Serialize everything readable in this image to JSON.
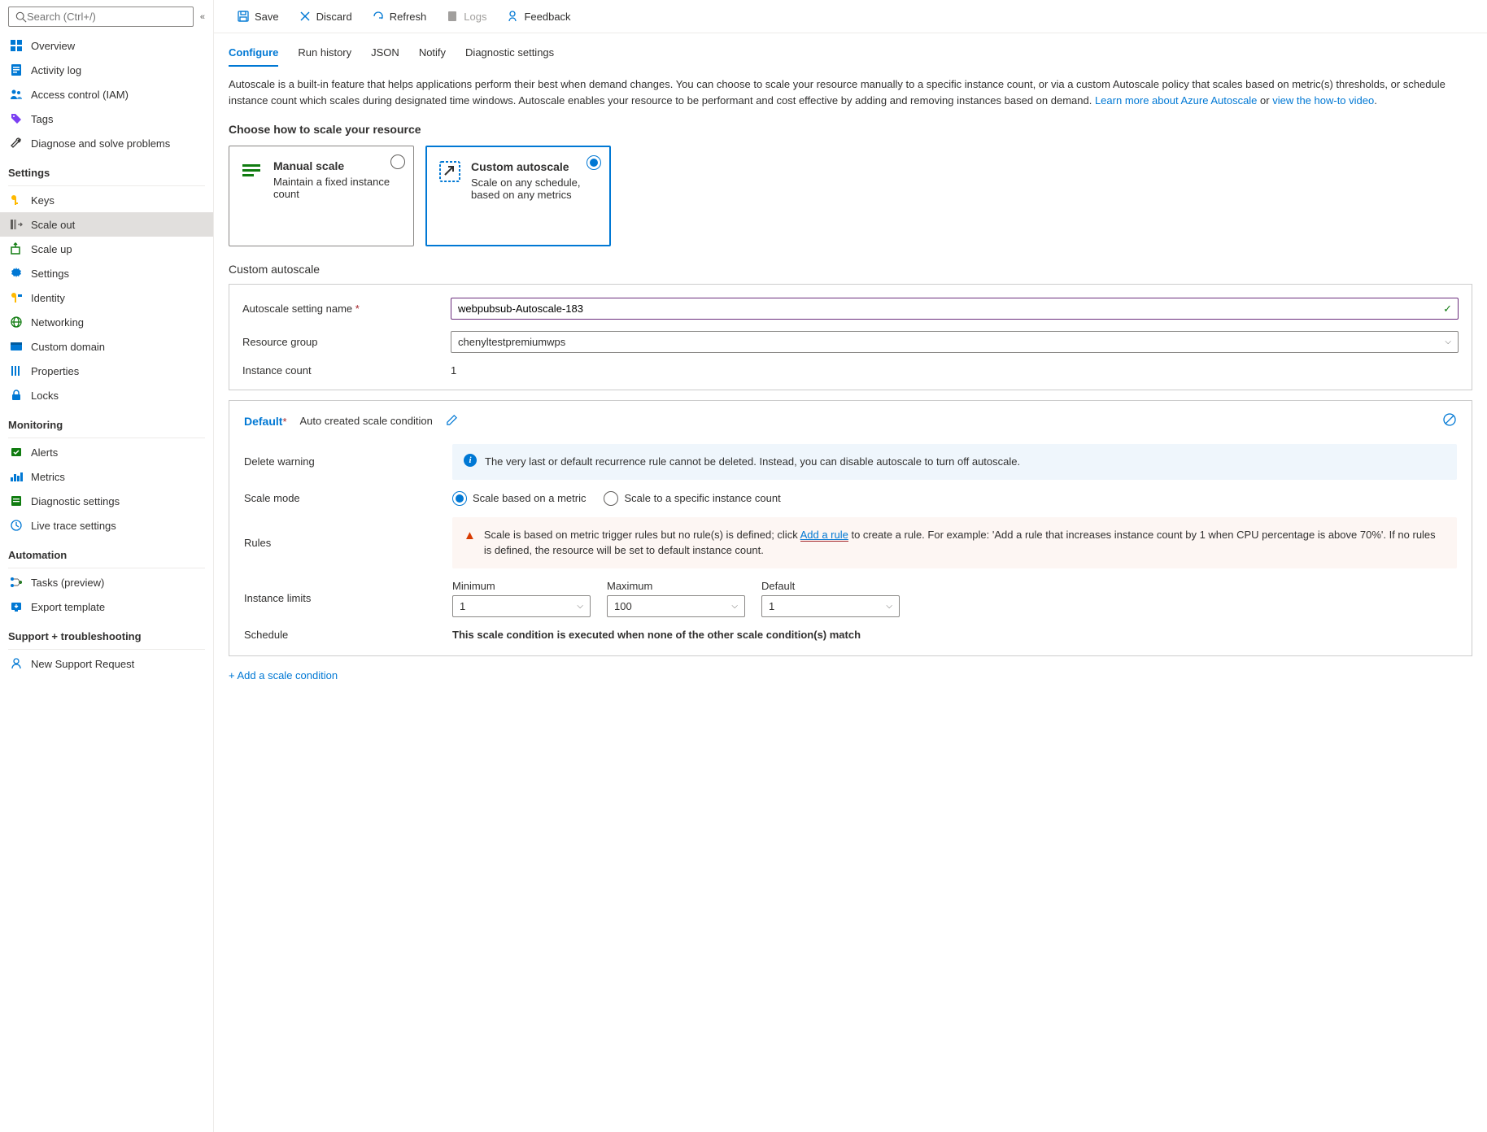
{
  "search": {
    "placeholder": "Search (Ctrl+/)"
  },
  "nav": {
    "overview": "Overview",
    "activity": "Activity log",
    "iam": "Access control (IAM)",
    "tags": "Tags",
    "diagnose": "Diagnose and solve problems",
    "settings_header": "Settings",
    "keys": "Keys",
    "scaleout": "Scale out",
    "scaleup": "Scale up",
    "settings": "Settings",
    "identity": "Identity",
    "networking": "Networking",
    "customdomain": "Custom domain",
    "properties": "Properties",
    "locks": "Locks",
    "monitoring_header": "Monitoring",
    "alerts": "Alerts",
    "metrics": "Metrics",
    "diagset": "Diagnostic settings",
    "livetrace": "Live trace settings",
    "automation_header": "Automation",
    "tasks": "Tasks (preview)",
    "export": "Export template",
    "support_header": "Support + troubleshooting",
    "newsupport": "New Support Request"
  },
  "toolbar": {
    "save": "Save",
    "discard": "Discard",
    "refresh": "Refresh",
    "logs": "Logs",
    "feedback": "Feedback"
  },
  "tabs": {
    "configure": "Configure",
    "history": "Run history",
    "json": "JSON",
    "notify": "Notify",
    "diag": "Diagnostic settings"
  },
  "intro": {
    "text": "Autoscale is a built-in feature that helps applications perform their best when demand changes. You can choose to scale your resource manually to a specific instance count, or via a custom Autoscale policy that scales based on metric(s) thresholds, or schedule instance count which scales during designated time windows. Autoscale enables your resource to be performant and cost effective by adding and removing instances based on demand. ",
    "link1": "Learn more about Azure Autoscale",
    "or": " or ",
    "link2": "view the how-to video",
    "period": "."
  },
  "choose_title": "Choose how to scale your resource",
  "cards": {
    "manual": {
      "title": "Manual scale",
      "desc": "Maintain a fixed instance count"
    },
    "custom": {
      "title": "Custom autoscale",
      "desc": "Scale on any schedule, based on any metrics"
    }
  },
  "custom_header": "Custom autoscale",
  "form": {
    "name_label": "Autoscale setting name",
    "name_value": "webpubsub-Autoscale-183",
    "rg_label": "Resource group",
    "rg_value": "chenyltestpremiumwps",
    "count_label": "Instance count",
    "count_value": "1"
  },
  "cond": {
    "default": "Default",
    "subtitle": "Auto created scale condition",
    "delete_label": "Delete warning",
    "delete_msg": "The very last or default recurrence rule cannot be deleted. Instead, you can disable autoscale to turn off autoscale.",
    "mode_label": "Scale mode",
    "mode_metric": "Scale based on a metric",
    "mode_count": "Scale to a specific instance count",
    "rules_label": "Rules",
    "rules_msg1": "Scale is based on metric trigger rules but no rule(s) is defined; click ",
    "rules_link": "Add a rule",
    "rules_msg2": " to create a rule. For example: 'Add a rule that increases instance count by 1 when CPU percentage is above 70%'. If no rules is defined, the resource will be set to default instance count.",
    "limits_label": "Instance limits",
    "min_label": "Minimum",
    "min_val": "1",
    "max_label": "Maximum",
    "max_val": "100",
    "def_label": "Default",
    "def_val": "1",
    "sched_label": "Schedule",
    "sched_text": "This scale condition is executed when none of the other scale condition(s) match"
  },
  "add_cond": "+  Add a scale condition"
}
